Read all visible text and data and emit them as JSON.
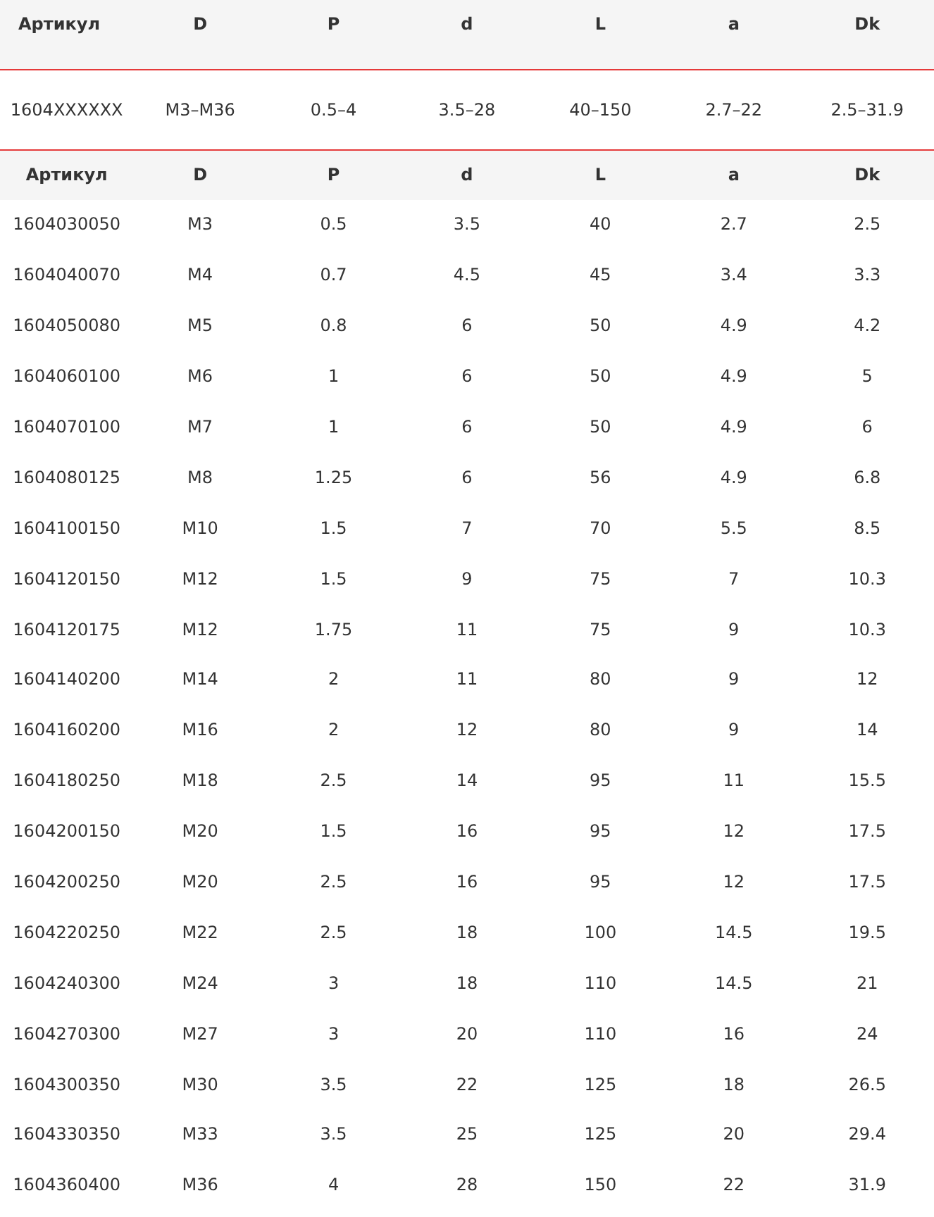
{
  "summary_table": {
    "columns": [
      "Артикул",
      "D",
      "P",
      "d",
      "L",
      "a",
      "Dk"
    ],
    "rows": [
      [
        "1604XXXXXX",
        "M3–M36",
        "0.5–4",
        "3.5–28",
        "40–150",
        "2.7–22",
        "2.5–31.9"
      ]
    ]
  },
  "detail_table": {
    "columns": [
      "Артикул",
      "D",
      "P",
      "d",
      "L",
      "a",
      "Dk"
    ],
    "rows": [
      [
        "1604030050",
        "M3",
        "0.5",
        "3.5",
        "40",
        "2.7",
        "2.5"
      ],
      [
        "1604040070",
        "M4",
        "0.7",
        "4.5",
        "45",
        "3.4",
        "3.3"
      ],
      [
        "1604050080",
        "M5",
        "0.8",
        "6",
        "50",
        "4.9",
        "4.2"
      ],
      [
        "1604060100",
        "M6",
        "1",
        "6",
        "50",
        "4.9",
        "5"
      ],
      [
        "1604070100",
        "M7",
        "1",
        "6",
        "50",
        "4.9",
        "6"
      ],
      [
        "1604080125",
        "M8",
        "1.25",
        "6",
        "56",
        "4.9",
        "6.8"
      ],
      [
        "1604100150",
        "M10",
        "1.5",
        "7",
        "70",
        "5.5",
        "8.5"
      ],
      [
        "1604120150",
        "M12",
        "1.5",
        "9",
        "75",
        "7",
        "10.3"
      ],
      [
        "1604120175",
        "M12",
        "1.75",
        "11",
        "75",
        "9",
        "10.3"
      ],
      [
        "1604140200",
        "M14",
        "2",
        "11",
        "80",
        "9",
        "12"
      ],
      [
        "1604160200",
        "M16",
        "2",
        "12",
        "80",
        "9",
        "14"
      ],
      [
        "1604180250",
        "M18",
        "2.5",
        "14",
        "95",
        "11",
        "15.5"
      ],
      [
        "1604200150",
        "M20",
        "1.5",
        "16",
        "95",
        "12",
        "17.5"
      ],
      [
        "1604200250",
        "M20",
        "2.5",
        "16",
        "95",
        "12",
        "17.5"
      ],
      [
        "1604220250",
        "M22",
        "2.5",
        "18",
        "100",
        "14.5",
        "19.5"
      ],
      [
        "1604240300",
        "M24",
        "3",
        "18",
        "110",
        "14.5",
        "21"
      ],
      [
        "1604270300",
        "M27",
        "3",
        "20",
        "110",
        "16",
        "24"
      ],
      [
        "1604300350",
        "M30",
        "3.5",
        "22",
        "125",
        "18",
        "26.5"
      ],
      [
        "1604330350",
        "M33",
        "3.5",
        "25",
        "125",
        "20",
        "29.4"
      ],
      [
        "1604360400",
        "M36",
        "4",
        "28",
        "150",
        "22",
        "31.9"
      ]
    ]
  }
}
